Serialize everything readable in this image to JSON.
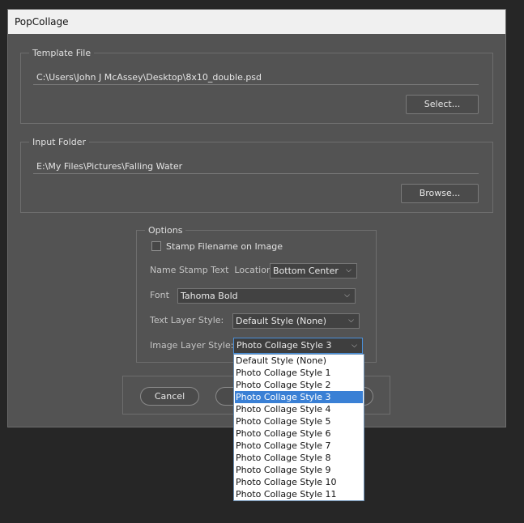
{
  "window": {
    "title": "PopCollage"
  },
  "template_group": {
    "legend": "Template File",
    "path": "C:\\Users\\John J McAssey\\Desktop\\8x10_double.psd",
    "button": "Select..."
  },
  "input_group": {
    "legend": "Input Folder",
    "path": "E:\\My Files\\Pictures\\Falling Water",
    "button": "Browse..."
  },
  "options": {
    "legend": "Options",
    "stamp_checkbox_label": "Stamp Filename on Image",
    "stamp_checked": false,
    "name_stamp_label": "Name Stamp Text  Location:",
    "location_value": "Bottom Center",
    "font_label": "Font",
    "font_value": "Tahoma Bold",
    "text_layer_label": "Text Layer Style:",
    "text_layer_value": "Default Style (None)",
    "image_layer_label": "Image Layer Style:",
    "image_layer_value": "Photo Collage Style 3"
  },
  "footer": {
    "cancel": "Cancel"
  },
  "dropdown_list": {
    "options": [
      "Default Style (None)",
      "Photo Collage Style 1",
      "Photo Collage Style 2",
      "Photo Collage Style 3",
      "Photo Collage Style 4",
      "Photo Collage Style 5",
      "Photo Collage Style 6",
      "Photo Collage Style 7",
      "Photo Collage Style 8",
      "Photo Collage Style 9",
      "Photo Collage Style 10",
      "Photo Collage Style 11"
    ],
    "selected_index": 3
  },
  "icons": {
    "dropdown": "chevron-down-icon"
  },
  "colors": {
    "selection": "#3a80d5",
    "dialog_bg": "#535353",
    "desktop_bg": "#262626"
  }
}
